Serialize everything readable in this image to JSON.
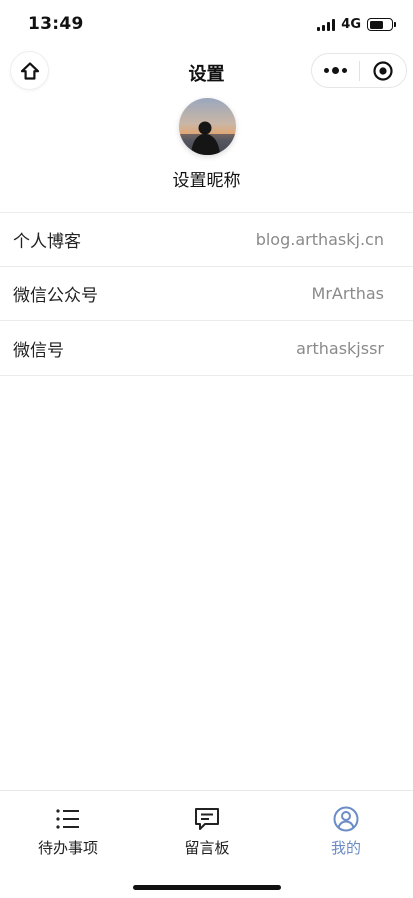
{
  "status_bar": {
    "time": "13:49",
    "network": "4G",
    "battery_level": 0.55
  },
  "nav": {
    "title": "设置",
    "home_icon": "home-icon",
    "more_icon": "more-dots-icon",
    "close_icon": "target-close-icon"
  },
  "profile": {
    "nickname": "设置昵称"
  },
  "settings": {
    "rows": [
      {
        "label": "个人博客",
        "value": "blog.arthaskj.cn"
      },
      {
        "label": "微信公众号",
        "value": "MrArthas"
      },
      {
        "label": "微信号",
        "value": "arthaskjssr"
      }
    ]
  },
  "tabs": [
    {
      "label": "待办事项",
      "icon": "list-icon",
      "active": false
    },
    {
      "label": "留言板",
      "icon": "message-board-icon",
      "active": false
    },
    {
      "label": "我的",
      "icon": "user-profile-icon",
      "active": true
    }
  ],
  "colors": {
    "active_tab": "#6b8cc7",
    "value_text": "#8a8a8a"
  }
}
